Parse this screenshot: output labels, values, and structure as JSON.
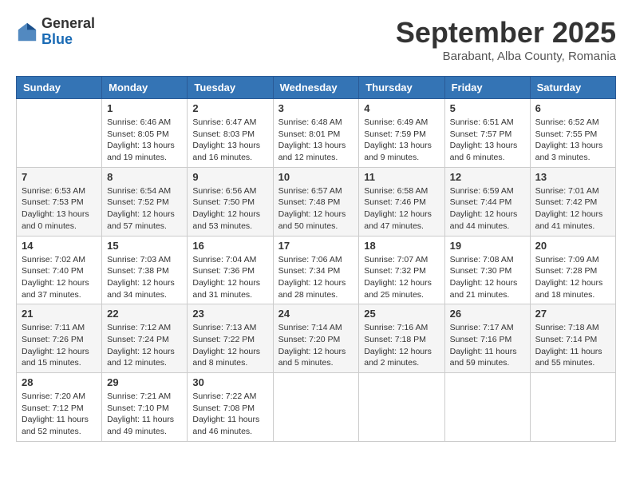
{
  "logo": {
    "general": "General",
    "blue": "Blue"
  },
  "title": "September 2025",
  "subtitle": "Barabant, Alba County, Romania",
  "days_of_week": [
    "Sunday",
    "Monday",
    "Tuesday",
    "Wednesday",
    "Thursday",
    "Friday",
    "Saturday"
  ],
  "weeks": [
    [
      {
        "day": "",
        "info": ""
      },
      {
        "day": "1",
        "info": "Sunrise: 6:46 AM\nSunset: 8:05 PM\nDaylight: 13 hours\nand 19 minutes."
      },
      {
        "day": "2",
        "info": "Sunrise: 6:47 AM\nSunset: 8:03 PM\nDaylight: 13 hours\nand 16 minutes."
      },
      {
        "day": "3",
        "info": "Sunrise: 6:48 AM\nSunset: 8:01 PM\nDaylight: 13 hours\nand 12 minutes."
      },
      {
        "day": "4",
        "info": "Sunrise: 6:49 AM\nSunset: 7:59 PM\nDaylight: 13 hours\nand 9 minutes."
      },
      {
        "day": "5",
        "info": "Sunrise: 6:51 AM\nSunset: 7:57 PM\nDaylight: 13 hours\nand 6 minutes."
      },
      {
        "day": "6",
        "info": "Sunrise: 6:52 AM\nSunset: 7:55 PM\nDaylight: 13 hours\nand 3 minutes."
      }
    ],
    [
      {
        "day": "7",
        "info": "Sunrise: 6:53 AM\nSunset: 7:53 PM\nDaylight: 13 hours\nand 0 minutes."
      },
      {
        "day": "8",
        "info": "Sunrise: 6:54 AM\nSunset: 7:52 PM\nDaylight: 12 hours\nand 57 minutes."
      },
      {
        "day": "9",
        "info": "Sunrise: 6:56 AM\nSunset: 7:50 PM\nDaylight: 12 hours\nand 53 minutes."
      },
      {
        "day": "10",
        "info": "Sunrise: 6:57 AM\nSunset: 7:48 PM\nDaylight: 12 hours\nand 50 minutes."
      },
      {
        "day": "11",
        "info": "Sunrise: 6:58 AM\nSunset: 7:46 PM\nDaylight: 12 hours\nand 47 minutes."
      },
      {
        "day": "12",
        "info": "Sunrise: 6:59 AM\nSunset: 7:44 PM\nDaylight: 12 hours\nand 44 minutes."
      },
      {
        "day": "13",
        "info": "Sunrise: 7:01 AM\nSunset: 7:42 PM\nDaylight: 12 hours\nand 41 minutes."
      }
    ],
    [
      {
        "day": "14",
        "info": "Sunrise: 7:02 AM\nSunset: 7:40 PM\nDaylight: 12 hours\nand 37 minutes."
      },
      {
        "day": "15",
        "info": "Sunrise: 7:03 AM\nSunset: 7:38 PM\nDaylight: 12 hours\nand 34 minutes."
      },
      {
        "day": "16",
        "info": "Sunrise: 7:04 AM\nSunset: 7:36 PM\nDaylight: 12 hours\nand 31 minutes."
      },
      {
        "day": "17",
        "info": "Sunrise: 7:06 AM\nSunset: 7:34 PM\nDaylight: 12 hours\nand 28 minutes."
      },
      {
        "day": "18",
        "info": "Sunrise: 7:07 AM\nSunset: 7:32 PM\nDaylight: 12 hours\nand 25 minutes."
      },
      {
        "day": "19",
        "info": "Sunrise: 7:08 AM\nSunset: 7:30 PM\nDaylight: 12 hours\nand 21 minutes."
      },
      {
        "day": "20",
        "info": "Sunrise: 7:09 AM\nSunset: 7:28 PM\nDaylight: 12 hours\nand 18 minutes."
      }
    ],
    [
      {
        "day": "21",
        "info": "Sunrise: 7:11 AM\nSunset: 7:26 PM\nDaylight: 12 hours\nand 15 minutes."
      },
      {
        "day": "22",
        "info": "Sunrise: 7:12 AM\nSunset: 7:24 PM\nDaylight: 12 hours\nand 12 minutes."
      },
      {
        "day": "23",
        "info": "Sunrise: 7:13 AM\nSunset: 7:22 PM\nDaylight: 12 hours\nand 8 minutes."
      },
      {
        "day": "24",
        "info": "Sunrise: 7:14 AM\nSunset: 7:20 PM\nDaylight: 12 hours\nand 5 minutes."
      },
      {
        "day": "25",
        "info": "Sunrise: 7:16 AM\nSunset: 7:18 PM\nDaylight: 12 hours\nand 2 minutes."
      },
      {
        "day": "26",
        "info": "Sunrise: 7:17 AM\nSunset: 7:16 PM\nDaylight: 11 hours\nand 59 minutes."
      },
      {
        "day": "27",
        "info": "Sunrise: 7:18 AM\nSunset: 7:14 PM\nDaylight: 11 hours\nand 55 minutes."
      }
    ],
    [
      {
        "day": "28",
        "info": "Sunrise: 7:20 AM\nSunset: 7:12 PM\nDaylight: 11 hours\nand 52 minutes."
      },
      {
        "day": "29",
        "info": "Sunrise: 7:21 AM\nSunset: 7:10 PM\nDaylight: 11 hours\nand 49 minutes."
      },
      {
        "day": "30",
        "info": "Sunrise: 7:22 AM\nSunset: 7:08 PM\nDaylight: 11 hours\nand 46 minutes."
      },
      {
        "day": "",
        "info": ""
      },
      {
        "day": "",
        "info": ""
      },
      {
        "day": "",
        "info": ""
      },
      {
        "day": "",
        "info": ""
      }
    ]
  ]
}
